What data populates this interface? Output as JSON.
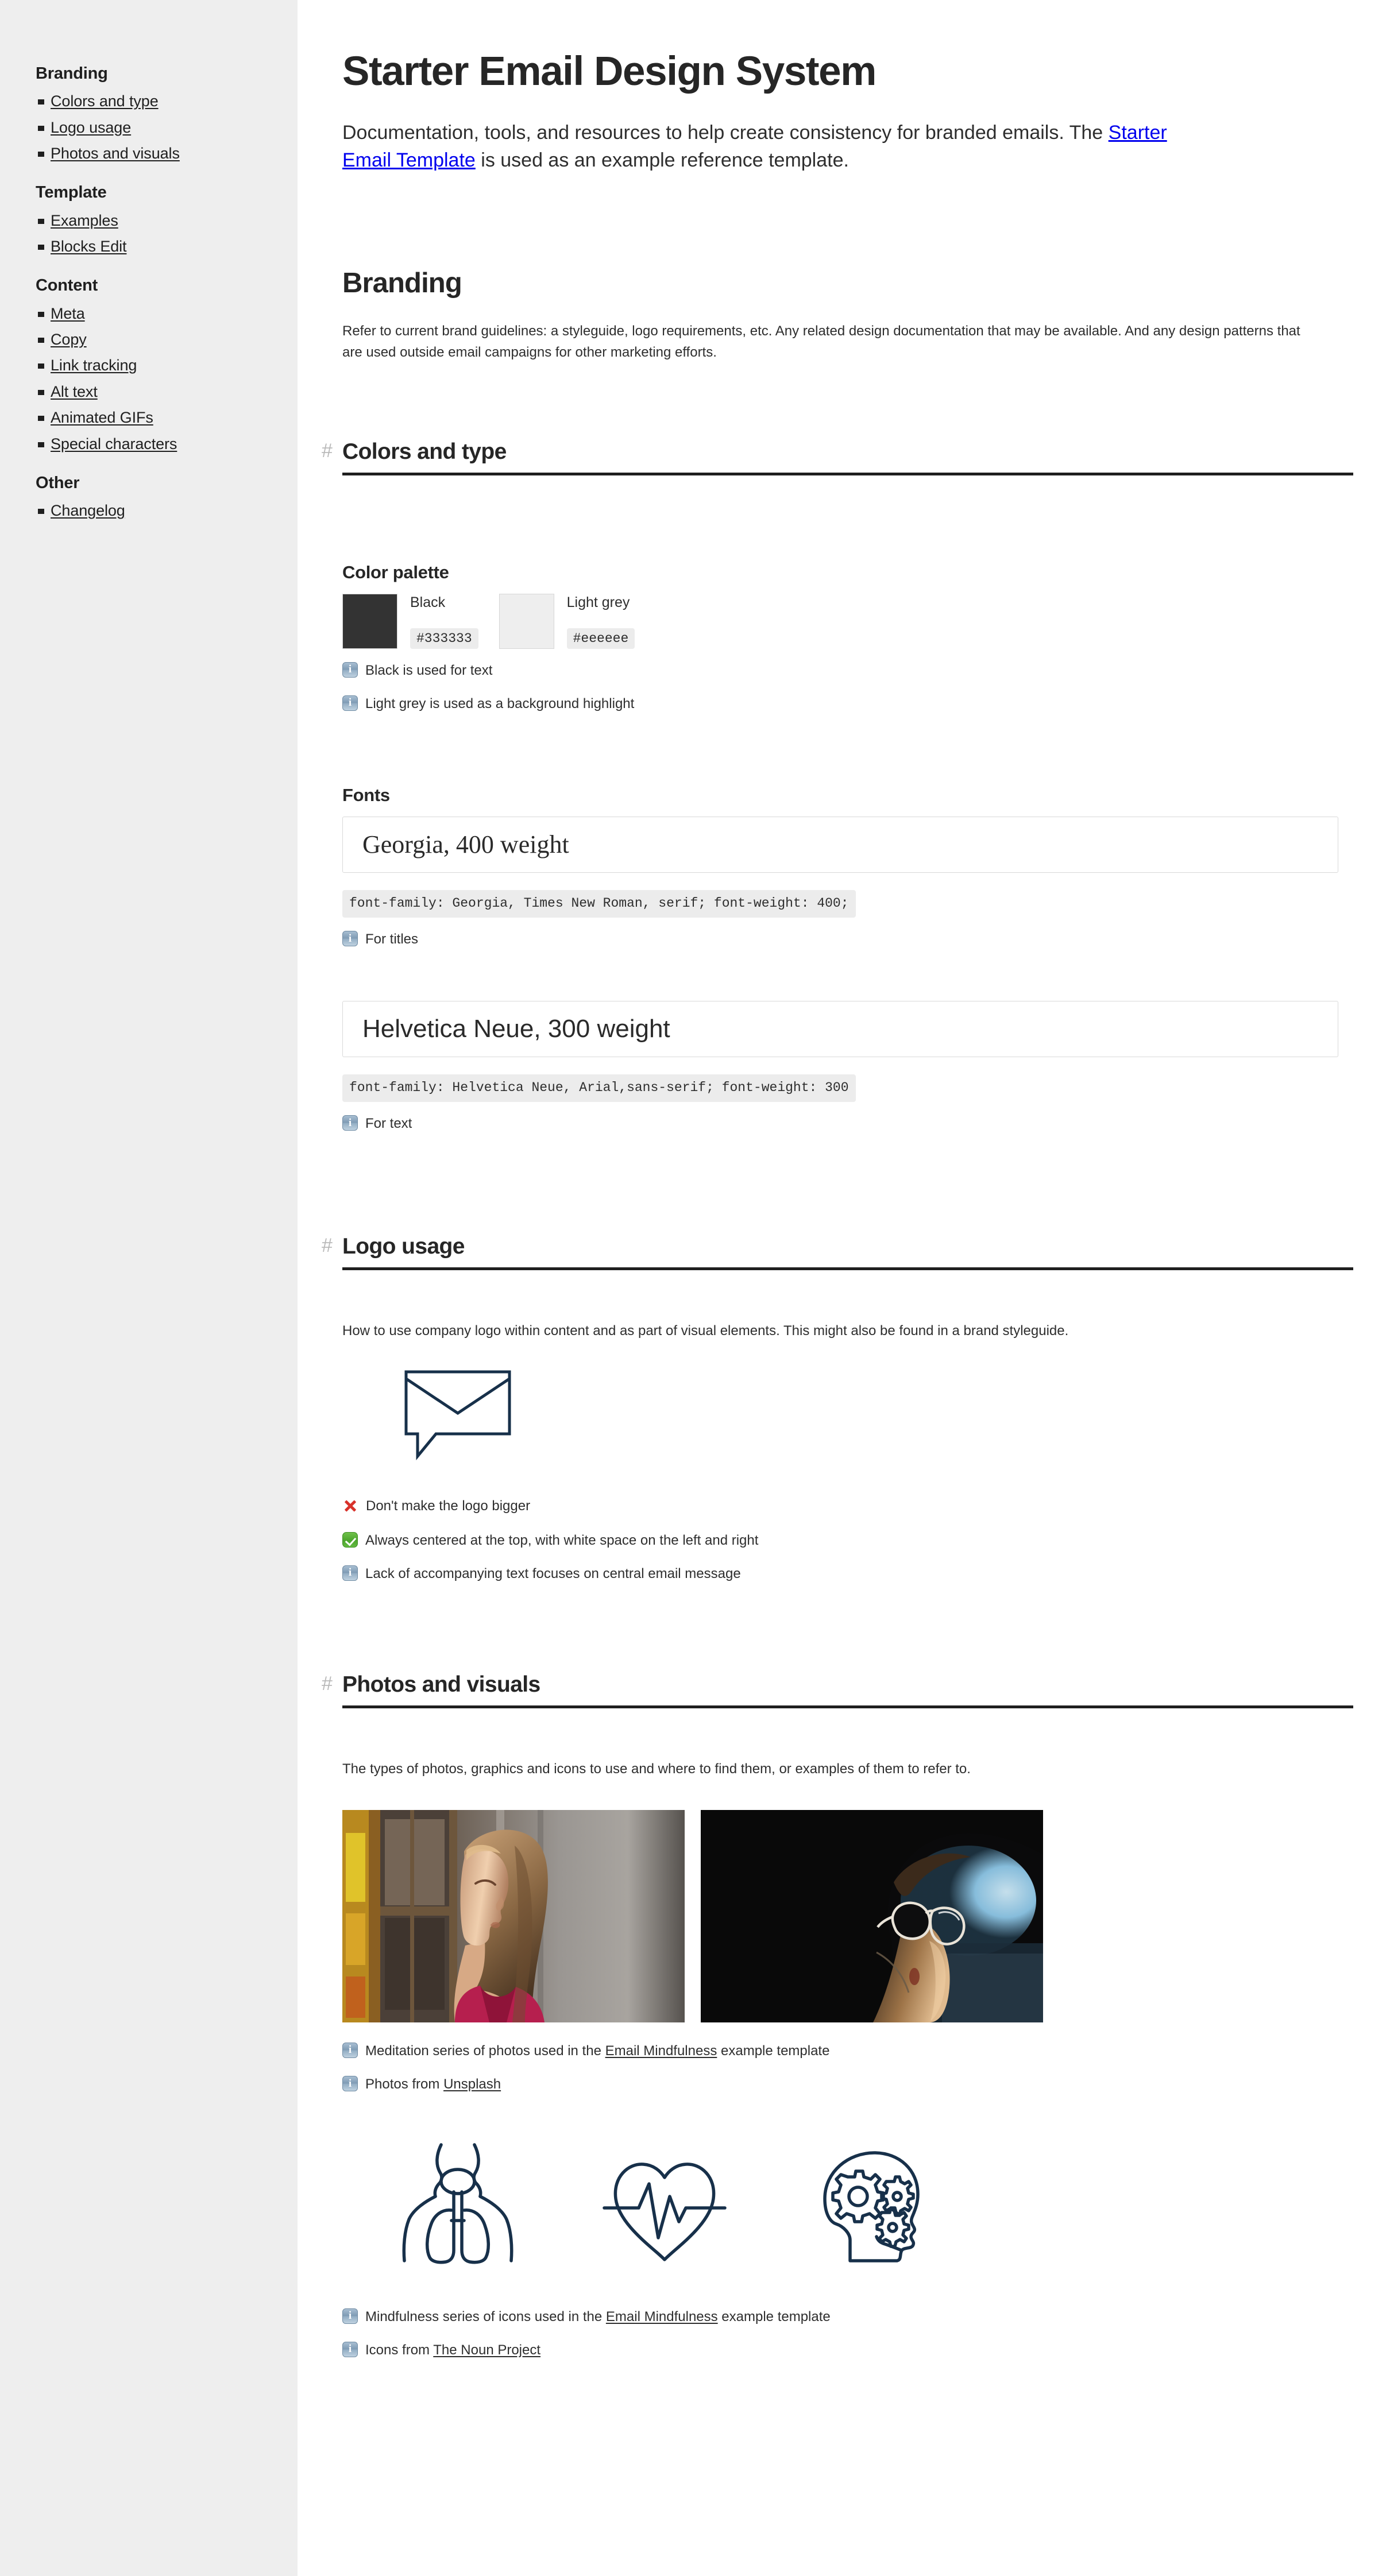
{
  "sidebar": {
    "groups": [
      {
        "title": "Branding",
        "items": [
          {
            "label": "Colors and type"
          },
          {
            "label": "Logo usage"
          },
          {
            "label": "Photos and visuals"
          }
        ]
      },
      {
        "title": "Template",
        "items": [
          {
            "label": "Examples"
          },
          {
            "label": "Blocks Edit"
          }
        ]
      },
      {
        "title": "Content",
        "items": [
          {
            "label": "Meta"
          },
          {
            "label": "Copy"
          },
          {
            "label": "Link tracking"
          },
          {
            "label": "Alt text"
          },
          {
            "label": "Animated GIFs"
          },
          {
            "label": "Special characters"
          }
        ]
      },
      {
        "title": "Other",
        "items": [
          {
            "label": "Changelog"
          }
        ]
      }
    ]
  },
  "header": {
    "title": "Starter Email Design System",
    "lede_part1": "Documentation, tools, and resources to help create consistency for branded emails. The ",
    "lede_link": "Starter Email Template",
    "lede_part2": " is used as an example reference template."
  },
  "branding": {
    "heading": "Branding",
    "intro": "Refer to current brand guidelines: a styleguide, logo requirements, etc. Any related design documentation that may be available. And any design patterns that are used outside email campaigns for other marketing efforts."
  },
  "colors_and_type": {
    "hash": "#",
    "heading": "Colors and type",
    "palette_heading": "Color palette",
    "swatches": [
      {
        "name": "Black",
        "hex": "#333333",
        "color": "#333333"
      },
      {
        "name": "Light grey",
        "hex": "#eeeeee",
        "color": "#eeeeee"
      }
    ],
    "palette_notes": [
      {
        "icon": "info-icon",
        "text": "Black is used for text"
      },
      {
        "icon": "info-icon",
        "text": "Light grey is used as a background highlight"
      }
    ],
    "fonts_heading": "Fonts",
    "fonts": [
      {
        "specimen": "Georgia, 400 weight",
        "code": "font-family: Georgia, Times New Roman, serif; font-weight: 400;",
        "note_icon": "info-icon",
        "note": "For titles"
      },
      {
        "specimen": "Helvetica Neue, 300 weight",
        "code": "font-family: Helvetica Neue, Arial,sans-serif; font-weight: 300",
        "note_icon": "info-icon",
        "note": "For text"
      }
    ]
  },
  "logo_usage": {
    "hash": "#",
    "heading": "Logo usage",
    "intro": "How to use company logo within content and as part of visual elements. This might also be found in a brand styleguide.",
    "logo_icon": "envelope-speech-bubble-logo",
    "notes": [
      {
        "icon": "cross-mark-icon",
        "text": "Don't make the logo bigger"
      },
      {
        "icon": "check-mark-icon",
        "text": "Always centered at the top, with white space on the left and right"
      },
      {
        "icon": "info-icon",
        "text": "Lack of accompanying text focuses on central email message"
      }
    ]
  },
  "photos_and_visuals": {
    "hash": "#",
    "heading": "Photos and visuals",
    "intro": "The types of photos, graphics and icons to use and where to find them, or examples of them to refer to.",
    "photos": [
      {
        "alt": "Woman with closed eyes facing sunlight by a window"
      },
      {
        "alt": "Person wearing glasses in low light silhouette"
      }
    ],
    "photo_notes": [
      {
        "icon": "info-icon",
        "text_before": "Meditation series of photos used in the ",
        "link": "Email Mindfulness",
        "text_after": " example template"
      },
      {
        "icon": "info-icon",
        "text_before": "Photos from ",
        "link": "Unsplash",
        "text_after": ""
      }
    ],
    "icons": [
      {
        "name": "lungs-torso-icon"
      },
      {
        "name": "heartbeat-pulse-icon"
      },
      {
        "name": "head-gears-icon"
      }
    ],
    "icon_notes": [
      {
        "icon": "info-icon",
        "text_before": "Mindfulness series of icons used in the ",
        "link": "Email Mindfulness",
        "text_after": " example template"
      },
      {
        "icon": "info-icon",
        "text_before": "Icons from ",
        "link": "The Noun Project",
        "text_after": ""
      }
    ]
  },
  "theme": {
    "sidebar_bg": "#eeeeee",
    "text": "#333333",
    "rule": "#1f1f1f",
    "hash": "#b9b9b9",
    "icon_stroke": "#17304a",
    "code_bg": "#ececec"
  }
}
